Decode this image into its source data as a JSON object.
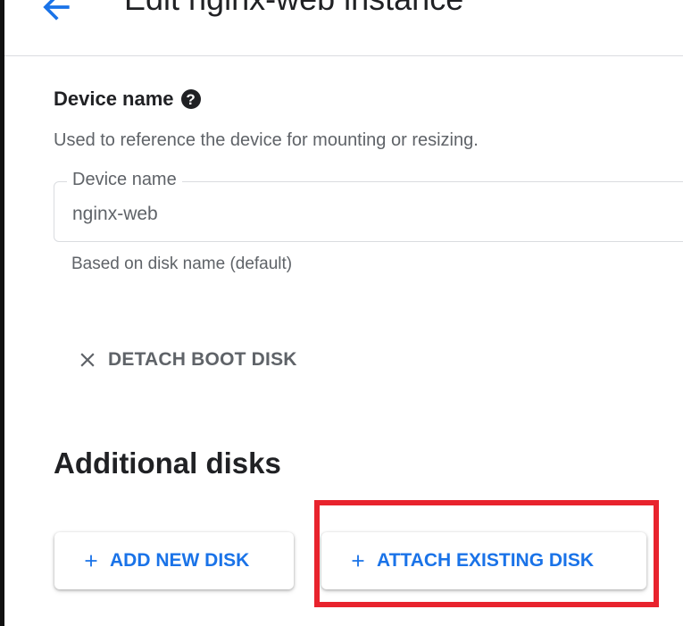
{
  "header": {
    "title": "Edit nginx-web instance",
    "back_icon": "arrow-back-icon"
  },
  "device_name_section": {
    "label": "Device name",
    "help_icon": "help-icon",
    "description": "Used to reference the device for mounting or resizing.",
    "field": {
      "label": "Device name",
      "value": "nginx-web",
      "hint": "Based on disk name (default)"
    }
  },
  "detach": {
    "label": "DETACH BOOT DISK",
    "icon": "close-icon"
  },
  "additional_disks": {
    "title": "Additional disks",
    "add_new_label": "ADD NEW DISK",
    "attach_existing_label": "ATTACH EXISTING DISK",
    "button_icon": "plus-icon"
  },
  "colors": {
    "accent": "#1a73e8",
    "highlight": "#e8232d",
    "text_primary": "#202124",
    "text_secondary": "#5f6368"
  }
}
